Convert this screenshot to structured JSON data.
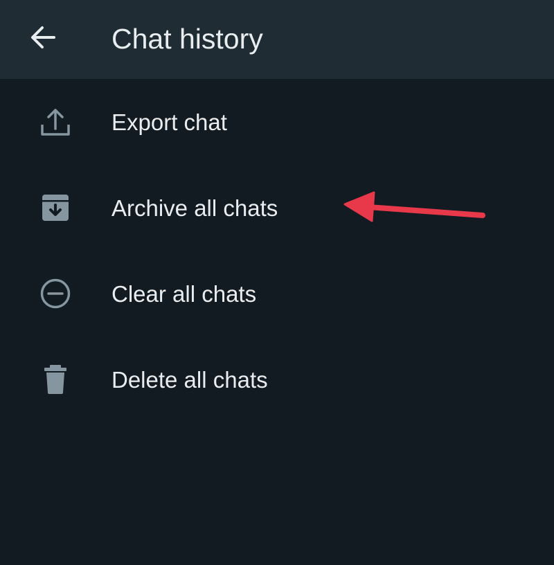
{
  "header": {
    "title": "Chat history",
    "back_icon": "arrow-back-icon"
  },
  "menu": {
    "items": [
      {
        "label": "Export chat",
        "icon": "export-icon"
      },
      {
        "label": "Archive all chats",
        "icon": "archive-icon"
      },
      {
        "label": "Clear all chats",
        "icon": "minus-circle-icon"
      },
      {
        "label": "Delete all chats",
        "icon": "trash-icon"
      }
    ]
  },
  "annotation": {
    "arrow_color": "#e8394a",
    "points_to": "Archive all chats"
  },
  "colors": {
    "background": "#121b22",
    "header_background": "#1f2c34",
    "text": "#e9edef",
    "icon": "#8696a0"
  }
}
